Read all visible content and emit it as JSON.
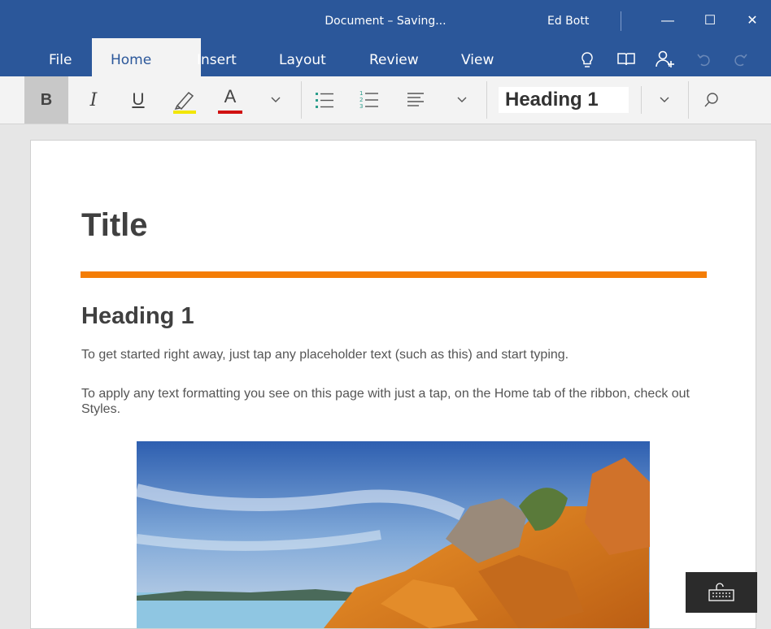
{
  "window": {
    "title": "Document – Saving...",
    "user": "Ed Bott",
    "controls": {
      "minimize": "—",
      "maximize": "☐",
      "close": "✕"
    }
  },
  "tabs": [
    {
      "label": "File",
      "active": false
    },
    {
      "label": "Home",
      "active": true
    },
    {
      "label": "Insert",
      "active": false
    },
    {
      "label": "Layout",
      "active": false
    },
    {
      "label": "Review",
      "active": false
    },
    {
      "label": "View",
      "active": false
    }
  ],
  "ribbon": {
    "bold": "B",
    "italic": "I",
    "underline": "U",
    "font_color": "A",
    "style_name": "Heading 1",
    "highlight_color": "#f2e600",
    "font_color_bar": "#d01010"
  },
  "document": {
    "title": "Title",
    "heading": "Heading 1",
    "paragraph1": "To get started right away, just tap any placeholder text (such as this) and start typing.",
    "paragraph2": "To apply any text formatting you see on this page with just a tap, on the Home tab of the ribbon, check out Styles."
  },
  "colors": {
    "accent": "#2b579a",
    "rule": "#f47d05"
  },
  "icons": [
    "lightbulb-icon",
    "book-icon",
    "share-person-icon",
    "undo-icon",
    "redo-icon",
    "search-icon",
    "keyboard-icon"
  ]
}
